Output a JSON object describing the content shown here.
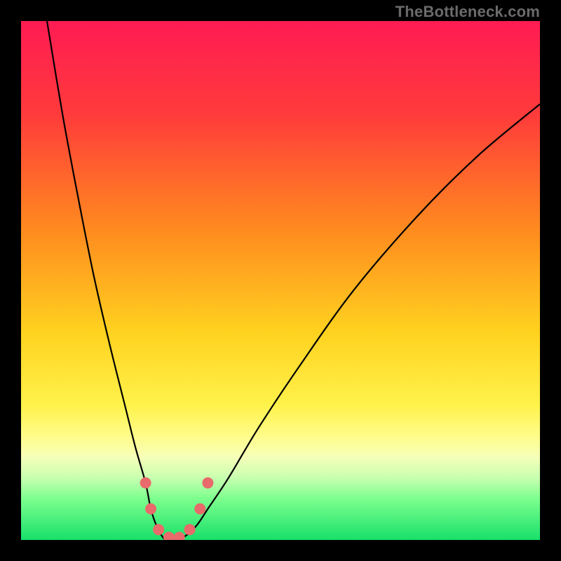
{
  "watermark": "TheBottleneck.com",
  "chart_data": {
    "type": "line",
    "title": "",
    "xlabel": "",
    "ylabel": "",
    "xlim": [
      0,
      100
    ],
    "ylim": [
      0,
      100
    ],
    "grid": false,
    "legend": false,
    "gradient_stops": [
      {
        "offset": 0,
        "color": "#ff1b53"
      },
      {
        "offset": 18,
        "color": "#ff3b3b"
      },
      {
        "offset": 40,
        "color": "#ff8a1f"
      },
      {
        "offset": 60,
        "color": "#ffd21f"
      },
      {
        "offset": 74,
        "color": "#fff24a"
      },
      {
        "offset": 80,
        "color": "#fffc8a"
      },
      {
        "offset": 84,
        "color": "#f6ffb8"
      },
      {
        "offset": 88,
        "color": "#c9ffb0"
      },
      {
        "offset": 92,
        "color": "#7dff8e"
      },
      {
        "offset": 100,
        "color": "#18e06a"
      }
    ],
    "series": [
      {
        "name": "bottleneck-curve",
        "x": [
          5,
          8,
          11,
          14,
          17,
          20,
          22,
          24,
          25,
          26,
          27,
          28,
          30,
          32,
          34,
          36,
          40,
          46,
          54,
          64,
          76,
          88,
          100
        ],
        "y": [
          100,
          82,
          66,
          51,
          38,
          26,
          18,
          11,
          6,
          3,
          1,
          0,
          0,
          1,
          3,
          6,
          12,
          22,
          34,
          48,
          62,
          74,
          84
        ]
      }
    ],
    "markers": {
      "name": "highlight-dots",
      "color": "#e86a6a",
      "radius": 8,
      "points": [
        {
          "x": 24.0,
          "y": 11.0
        },
        {
          "x": 25.0,
          "y": 6.0
        },
        {
          "x": 26.5,
          "y": 2.0
        },
        {
          "x": 28.5,
          "y": 0.5
        },
        {
          "x": 30.5,
          "y": 0.5
        },
        {
          "x": 32.5,
          "y": 2.0
        },
        {
          "x": 34.5,
          "y": 6.0
        },
        {
          "x": 36.0,
          "y": 11.0
        }
      ]
    }
  }
}
